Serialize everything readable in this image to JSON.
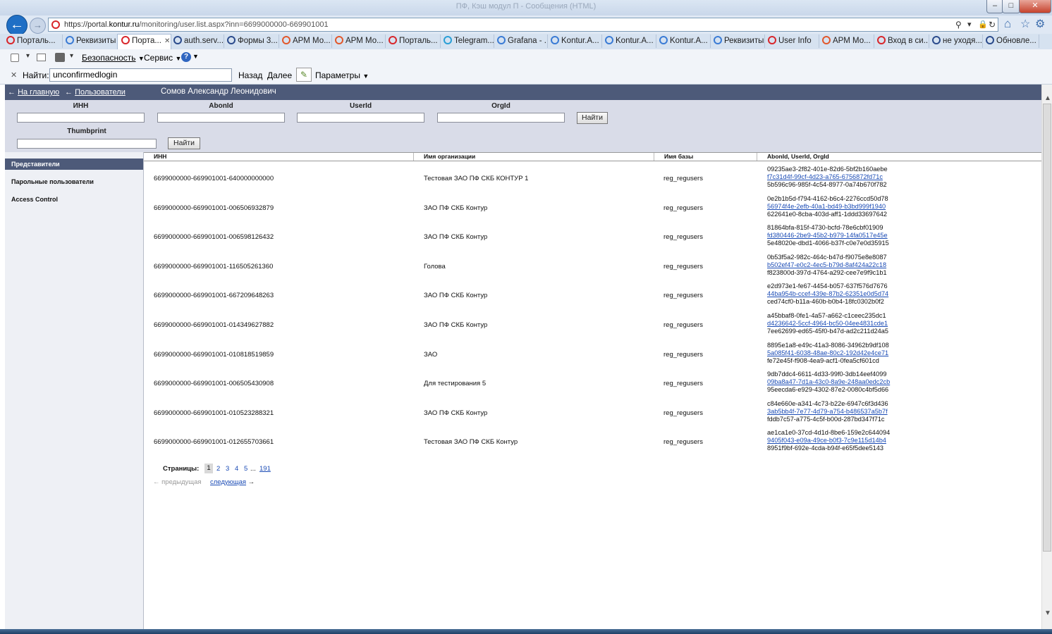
{
  "window": {
    "title": "ПФ, Кэш модул П - Сообщения (HTML)",
    "minimize": "–",
    "maximize": "□",
    "close": "✕"
  },
  "nav": {
    "url_prefix": "https://portal.",
    "url_domain": "kontur.ru",
    "url_path": "/monitoring/user.list.aspx?inn=6699000000-669901001"
  },
  "tabs": [
    {
      "label": "Порталь...",
      "color": "#d8262b"
    },
    {
      "label": "Реквизиты",
      "color": "#3a7bd5"
    },
    {
      "label": "Порта...",
      "color": "#d8262b",
      "active": true,
      "close": "✕"
    },
    {
      "label": "auth.serv...",
      "color": "#2b4b8c"
    },
    {
      "label": "Формы 3...",
      "color": "#2b4b8c"
    },
    {
      "label": "АРМ Мо...",
      "color": "#e2582b"
    },
    {
      "label": "АРМ Мо...",
      "color": "#e2582b"
    },
    {
      "label": "Порталь...",
      "color": "#d8262b"
    },
    {
      "label": "Telegram...",
      "color": "#2a9fd6"
    },
    {
      "label": "Grafana - ...",
      "color": "#3a7bd5"
    },
    {
      "label": "Kontur.A...",
      "color": "#3a7bd5"
    },
    {
      "label": "Kontur.A...",
      "color": "#3a7bd5"
    },
    {
      "label": "Kontur.A...",
      "color": "#3a7bd5"
    },
    {
      "label": "Реквизиты",
      "color": "#3a7bd5"
    },
    {
      "label": "User Info",
      "color": "#d8262b"
    },
    {
      "label": "АРМ Мо...",
      "color": "#e2582b"
    },
    {
      "label": "Вход в си...",
      "color": "#d8262b"
    },
    {
      "label": "не уходя...",
      "color": "#2b4b8c"
    },
    {
      "label": "Обновле...",
      "color": "#2b4b8c"
    }
  ],
  "cmdbar": {
    "security": "Безопасность",
    "service": "Сервис",
    "help": "?"
  },
  "findbar": {
    "close": "✕",
    "label": "Найти:",
    "query": "unconfirmedlogin",
    "back": "Назад",
    "forward": "Далее",
    "params": "Параметры"
  },
  "page": {
    "home_link": "На главную",
    "users_link": "Пользователи",
    "user_name": "Сомов Александр Леонидович",
    "arrow": "←"
  },
  "search": {
    "labels": {
      "inn": "ИНН",
      "abonid": "AbonId",
      "userid": "UserId",
      "orgid": "OrgId",
      "thumbprint": "Thumbprint"
    },
    "button": "Найти"
  },
  "sidebar": {
    "items": [
      "Представители",
      "Парольные пользователи",
      "Access Control"
    ]
  },
  "table": {
    "headers": [
      "ИНН",
      "Имя организации",
      "Имя базы",
      "AbonId, UserId, OrgId"
    ],
    "rows": [
      {
        "inn": "6699000000-669901001-640000000000",
        "org": "Тестовая ЗАО ПФ СКБ КОНТУР 1",
        "db": "reg_regusers",
        "abon": "09235ae3-2f82-401e-82d6-5bf2b160aebe",
        "user": "f7c31d4f-99cf-4d23-a765-6756872fd71c",
        "orgid": "5b596c96-985f-4c54-8977-0a74b670f782"
      },
      {
        "inn": "6699000000-669901001-006506932879",
        "org": "ЗАО ПФ СКБ Контур",
        "db": "reg_regusers",
        "abon": "0e2b1b5d-f794-4162-b6c4-2276ccd50d78",
        "user": "56974f4e-2efb-40a1-bd49-b3bd999f1940",
        "orgid": "622641e0-8cba-403d-aff1-1ddd33697642"
      },
      {
        "inn": "6699000000-669901001-006598126432",
        "org": "ЗАО ПФ СКБ Контур",
        "db": "reg_regusers",
        "abon": "81864bfa-815f-4730-bcfd-78e6cbf01909",
        "user": "fd380446-2be9-45b2-b979-14fa0517e45e",
        "orgid": "5e48020e-dbd1-4066-b37f-c0e7e0d35915"
      },
      {
        "inn": "6699000000-669901001-116505261360",
        "org": "Голова",
        "db": "reg_regusers",
        "abon": "0b53f5a2-982c-464c-b47d-f9075e8e8087",
        "user": "b502ef47-e0c2-4ec5-b79d-8af424a22c18",
        "orgid": "f823800d-397d-4764-a292-cee7e9f9c1b1"
      },
      {
        "inn": "6699000000-669901001-667209648263",
        "org": "ЗАО ПФ СКБ Контур",
        "db": "reg_regusers",
        "abon": "e2d973e1-fe67-4454-b057-637f576d7676",
        "user": "44ba954b-ccef-439e-87b2-62351e0d5d74",
        "orgid": "ced74cf0-b11a-460b-b0b4-18fc0302b0f2"
      },
      {
        "inn": "6699000000-669901001-014349627882",
        "org": "ЗАО ПФ СКБ Контур",
        "db": "reg_regusers",
        "abon": "a45bbaf8-0fe1-4a57-a662-c1ceec235dc1",
        "user": "d4236642-5ccf-4964-bc50-04ee4831cde1",
        "orgid": "7ee62699-ed65-45f0-b47d-ad2c211d24a5"
      },
      {
        "inn": "6699000000-669901001-010818519859",
        "org": "ЗАО",
        "db": "reg_regusers",
        "abon": "8895e1a8-e49c-41a3-8086-34962b9df108",
        "user": "5a085f41-6038-48ae-80c2-192d42e4ce71",
        "orgid": "fe72e45f-f908-4ea9-acf1-0fea5cf601cd"
      },
      {
        "inn": "6699000000-669901001-006505430908",
        "org": "Для тестирования 5",
        "db": "reg_regusers",
        "abon": "9db7ddc4-6611-4d33-99f0-3db14eef4099",
        "user": "09ba8a47-7d1a-43c0-8a9e-248aa0edc2cb",
        "orgid": "95eecda6-e929-4302-87e2-0080c4bf5d66"
      },
      {
        "inn": "6699000000-669901001-010523288321",
        "org": "ЗАО ПФ СКБ Контур",
        "db": "reg_regusers",
        "abon": "c84e660e-a341-4c73-b22e-6947c6f3d436",
        "user": "3ab5bb4f-7e77-4d79-a754-b486537a5b7f",
        "orgid": "fddb7c57-a775-4c5f-b00d-287bd347f71c"
      },
      {
        "inn": "6699000000-669901001-012655703661",
        "org": "Тестовая ЗАО ПФ СКБ Контур",
        "db": "reg_regusers",
        "abon": "ae1ca1e0-37cd-4d1d-8be6-159e2c644094",
        "user": "9405f043-e09a-49ce-b0f3-7c9e115d14b4",
        "orgid": "8951f9bf-692e-4cda-b94f-e65f5dee5143"
      }
    ]
  },
  "pager": {
    "label": "Страницы:",
    "current": "1",
    "pages": [
      "2",
      "3",
      "4",
      "5"
    ],
    "ellipsis": "...",
    "last": "191",
    "prev": "← предыдущая",
    "next": "следующая",
    "next_arrow": "→"
  }
}
